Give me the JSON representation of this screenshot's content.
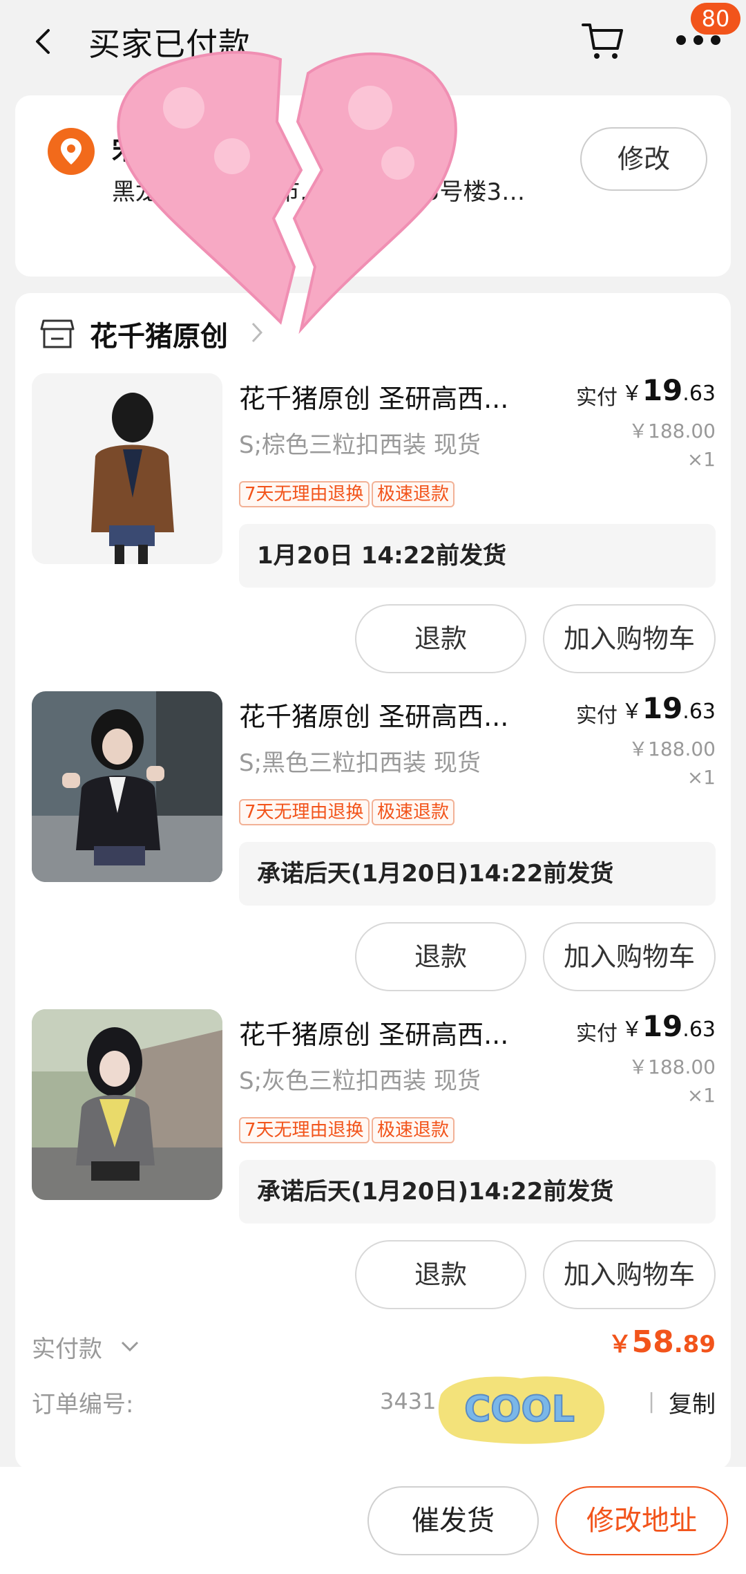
{
  "header": {
    "title": "买家已付款",
    "badge_count": "80"
  },
  "address": {
    "name": "宋",
    "line": "黑龙江省哈尔滨市…… 场小区5号楼3…",
    "edit_label": "修改"
  },
  "shop": {
    "name": "花千猪原创"
  },
  "items": [
    {
      "title": "花千猪原创 圣研高西...",
      "paid_label": "实付",
      "currency": "￥",
      "price_int": "19",
      "price_dec": ".63",
      "orig_price": "￥188.00",
      "qty": "×1",
      "sku": "S;棕色三粒扣西装 现货",
      "tag1": "7天无理由退换",
      "tag2": "极速退款",
      "ship": "1月20日 14:22前发货",
      "refund_label": "退款",
      "addcart_label": "加入购物车"
    },
    {
      "title": "花千猪原创 圣研高西...",
      "paid_label": "实付",
      "currency": "￥",
      "price_int": "19",
      "price_dec": ".63",
      "orig_price": "￥188.00",
      "qty": "×1",
      "sku": "S;黑色三粒扣西装 现货",
      "tag1": "7天无理由退换",
      "tag2": "极速退款",
      "ship": "承诺后天(1月20日)14:22前发货",
      "refund_label": "退款",
      "addcart_label": "加入购物车"
    },
    {
      "title": "花千猪原创 圣研高西...",
      "paid_label": "实付",
      "currency": "￥",
      "price_int": "19",
      "price_dec": ".63",
      "orig_price": "￥188.00",
      "qty": "×1",
      "sku": "S;灰色三粒扣西装 现货",
      "tag1": "7天无理由退换",
      "tag2": "极速退款",
      "ship": "承诺后天(1月20日)14:22前发货",
      "refund_label": "退款",
      "addcart_label": "加入购物车"
    }
  ],
  "summary": {
    "total_label": "实付款",
    "total_currency": "￥",
    "total_int": "58",
    "total_dec": ".89",
    "order_no_label": "订单编号:",
    "order_no": "3431… 463",
    "separator": "|",
    "copy_label": "复制"
  },
  "bottom": {
    "urge_label": "催发货",
    "change_addr_label": "修改地址"
  },
  "stickers": {
    "cool_text": "COOL"
  },
  "colors": {
    "accent": "#f2541b",
    "heart": "#f7a9c4"
  }
}
